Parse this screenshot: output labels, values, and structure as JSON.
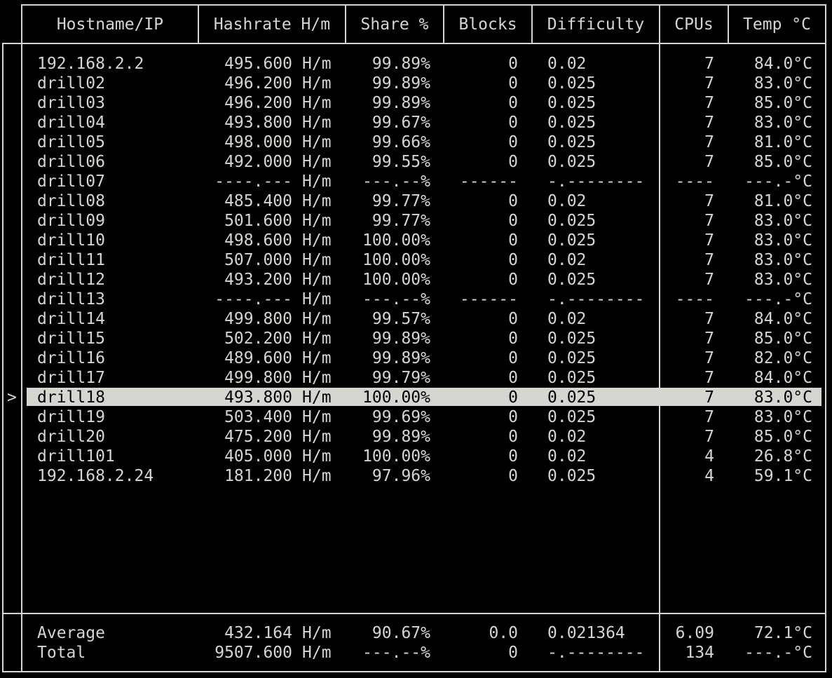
{
  "colors": {
    "background": "#000000",
    "foreground": "#d3d7cf",
    "selection_bg": "#d3d7cf",
    "selection_fg": "#000000"
  },
  "header": {
    "columns": [
      "Hostname/IP",
      "Hashrate H/m",
      "Share %",
      "Blocks",
      "Difficulty",
      "CPUs",
      "Temp °C"
    ]
  },
  "selected_index": 17,
  "cursor_glyph": ">",
  "rows": [
    {
      "host": "192.168.2.2",
      "hashrate": "495.600",
      "unit": "H/m",
      "share": "99.89%",
      "blocks": "0",
      "difficulty": "0.02",
      "cpus": "7",
      "temp": "84.0°C"
    },
    {
      "host": "drill02",
      "hashrate": "496.200",
      "unit": "H/m",
      "share": "99.89%",
      "blocks": "0",
      "difficulty": "0.025",
      "cpus": "7",
      "temp": "83.0°C"
    },
    {
      "host": "drill03",
      "hashrate": "496.200",
      "unit": "H/m",
      "share": "99.89%",
      "blocks": "0",
      "difficulty": "0.025",
      "cpus": "7",
      "temp": "85.0°C"
    },
    {
      "host": "drill04",
      "hashrate": "493.800",
      "unit": "H/m",
      "share": "99.67%",
      "blocks": "0",
      "difficulty": "0.025",
      "cpus": "7",
      "temp": "83.0°C"
    },
    {
      "host": "drill05",
      "hashrate": "498.000",
      "unit": "H/m",
      "share": "99.66%",
      "blocks": "0",
      "difficulty": "0.025",
      "cpus": "7",
      "temp": "81.0°C"
    },
    {
      "host": "drill06",
      "hashrate": "492.000",
      "unit": "H/m",
      "share": "99.55%",
      "blocks": "0",
      "difficulty": "0.025",
      "cpus": "7",
      "temp": "85.0°C"
    },
    {
      "host": "drill07",
      "hashrate": "----.---",
      "unit": "H/m",
      "share": "---.--%",
      "blocks": "------",
      "difficulty": "-.--------",
      "cpus": "----",
      "temp": "---.-°C"
    },
    {
      "host": "drill08",
      "hashrate": "485.400",
      "unit": "H/m",
      "share": "99.77%",
      "blocks": "0",
      "difficulty": "0.02",
      "cpus": "7",
      "temp": "81.0°C"
    },
    {
      "host": "drill09",
      "hashrate": "501.600",
      "unit": "H/m",
      "share": "99.77%",
      "blocks": "0",
      "difficulty": "0.025",
      "cpus": "7",
      "temp": "83.0°C"
    },
    {
      "host": "drill10",
      "hashrate": "498.600",
      "unit": "H/m",
      "share": "100.00%",
      "blocks": "0",
      "difficulty": "0.025",
      "cpus": "7",
      "temp": "83.0°C"
    },
    {
      "host": "drill11",
      "hashrate": "507.000",
      "unit": "H/m",
      "share": "100.00%",
      "blocks": "0",
      "difficulty": "0.02",
      "cpus": "7",
      "temp": "83.0°C"
    },
    {
      "host": "drill12",
      "hashrate": "493.200",
      "unit": "H/m",
      "share": "100.00%",
      "blocks": "0",
      "difficulty": "0.025",
      "cpus": "7",
      "temp": "83.0°C"
    },
    {
      "host": "drill13",
      "hashrate": "----.---",
      "unit": "H/m",
      "share": "---.--%",
      "blocks": "------",
      "difficulty": "-.--------",
      "cpus": "----",
      "temp": "---.-°C"
    },
    {
      "host": "drill14",
      "hashrate": "499.800",
      "unit": "H/m",
      "share": "99.57%",
      "blocks": "0",
      "difficulty": "0.02",
      "cpus": "7",
      "temp": "84.0°C"
    },
    {
      "host": "drill15",
      "hashrate": "502.200",
      "unit": "H/m",
      "share": "99.89%",
      "blocks": "0",
      "difficulty": "0.025",
      "cpus": "7",
      "temp": "85.0°C"
    },
    {
      "host": "drill16",
      "hashrate": "489.600",
      "unit": "H/m",
      "share": "99.89%",
      "blocks": "0",
      "difficulty": "0.025",
      "cpus": "7",
      "temp": "82.0°C"
    },
    {
      "host": "drill17",
      "hashrate": "499.800",
      "unit": "H/m",
      "share": "99.79%",
      "blocks": "0",
      "difficulty": "0.025",
      "cpus": "7",
      "temp": "84.0°C"
    },
    {
      "host": "drill18",
      "hashrate": "493.800",
      "unit": "H/m",
      "share": "100.00%",
      "blocks": "0",
      "difficulty": "0.025",
      "cpus": "7",
      "temp": "83.0°C"
    },
    {
      "host": "drill19",
      "hashrate": "503.400",
      "unit": "H/m",
      "share": "99.69%",
      "blocks": "0",
      "difficulty": "0.025",
      "cpus": "7",
      "temp": "83.0°C"
    },
    {
      "host": "drill20",
      "hashrate": "475.200",
      "unit": "H/m",
      "share": "99.89%",
      "blocks": "0",
      "difficulty": "0.02",
      "cpus": "7",
      "temp": "85.0°C"
    },
    {
      "host": "drill101",
      "hashrate": "405.000",
      "unit": "H/m",
      "share": "100.00%",
      "blocks": "0",
      "difficulty": "0.02",
      "cpus": "4",
      "temp": "26.8°C"
    },
    {
      "host": "192.168.2.24",
      "hashrate": "181.200",
      "unit": "H/m",
      "share": "97.96%",
      "blocks": "0",
      "difficulty": "0.025",
      "cpus": "4",
      "temp": "59.1°C"
    }
  ],
  "footer": [
    {
      "host": "Average",
      "hashrate": "432.164",
      "unit": "H/m",
      "share": "90.67%",
      "blocks": "0.0",
      "difficulty": "0.021364",
      "cpus": "6.09",
      "temp": "72.1°C"
    },
    {
      "host": "Total",
      "hashrate": "9507.600",
      "unit": "H/m",
      "share": "---.--%",
      "blocks": "0",
      "difficulty": "-.--------",
      "cpus": "134",
      "temp": "---.-°C"
    }
  ]
}
